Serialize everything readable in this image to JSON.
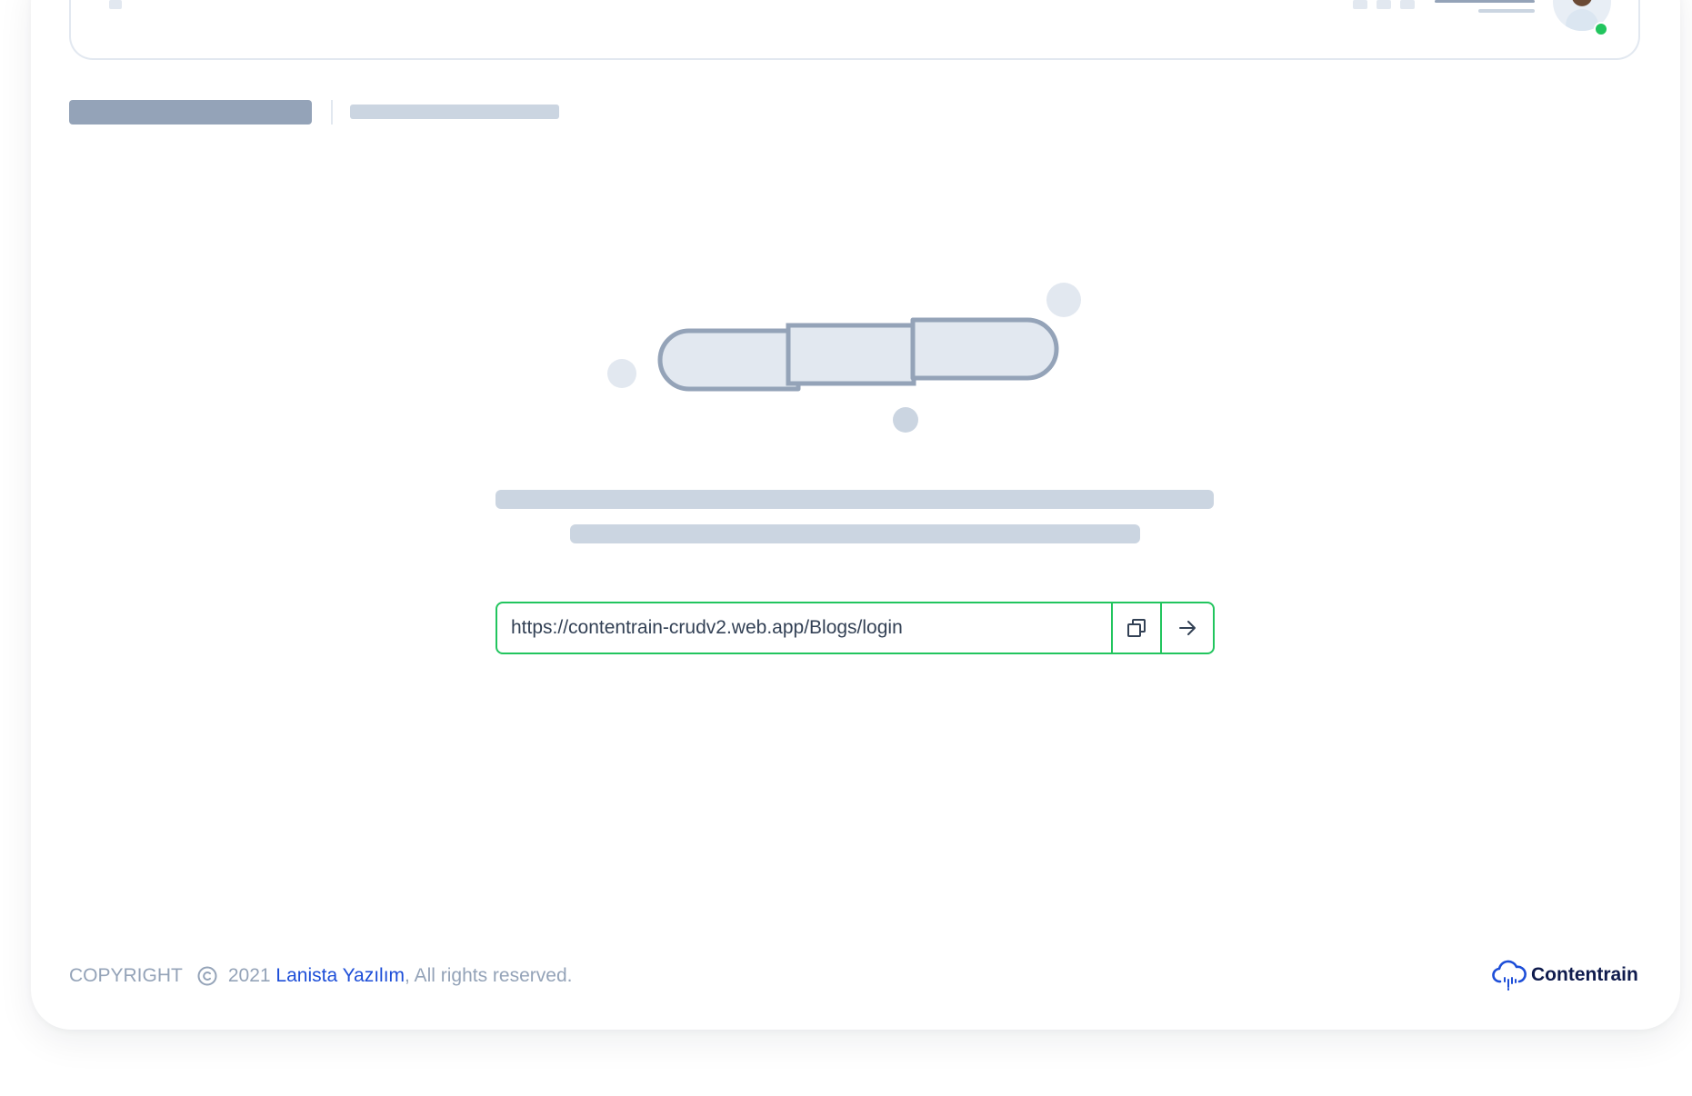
{
  "url_bar": {
    "value": "https://contentrain-crudv2.web.app/Blogs/login",
    "copy_icon": "copy-icon",
    "go_icon": "arrow-right-icon"
  },
  "footer": {
    "copyright_label": "COPYRIGHT",
    "copyright_icon": "copyright-icon",
    "year": "2021",
    "company": "Lanista Yazılım",
    "rights": ", All rights reserved."
  },
  "brand": {
    "name": "Contentrain",
    "icon": "cloud-rain-icon"
  },
  "colors": {
    "accent_green": "#22c55e",
    "link_blue": "#1d4ed8",
    "skeleton": "#cbd5e1",
    "skeleton_dark": "#94a3b8"
  }
}
